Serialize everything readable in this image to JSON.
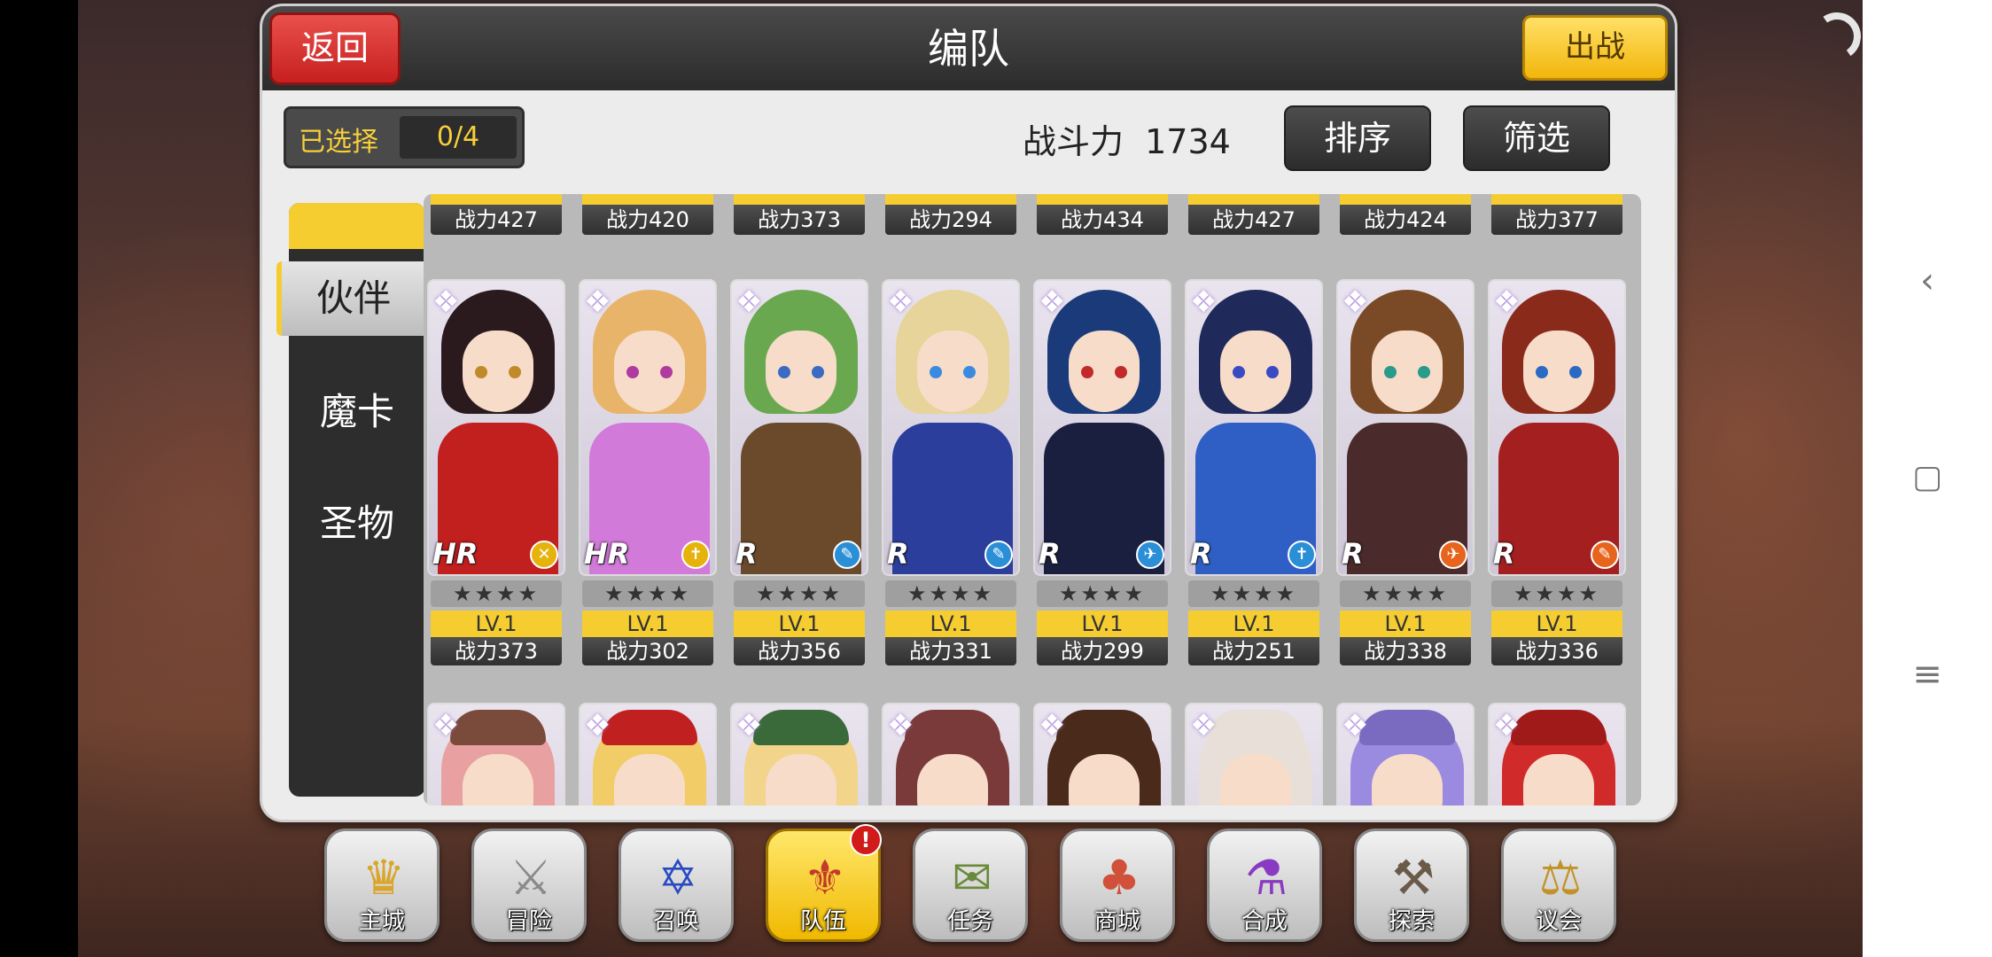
{
  "header": {
    "title": "编队",
    "back_label": "返回",
    "go_label": "出战"
  },
  "selection": {
    "label": "已选择",
    "value": "0/4"
  },
  "power": {
    "label": "战斗力",
    "value": "1734"
  },
  "toolbar": {
    "sort_label": "排序",
    "filter_label": "筛选"
  },
  "tabs": [
    {
      "label": "伙伴",
      "active": true
    },
    {
      "label": "魔卡",
      "active": false
    },
    {
      "label": "圣物",
      "active": false
    }
  ],
  "top_row_partial": [
    {
      "power": "战力427"
    },
    {
      "power": "战力420"
    },
    {
      "power": "战力373"
    },
    {
      "power": "战力294"
    },
    {
      "power": "战力434"
    },
    {
      "power": "战力427"
    },
    {
      "power": "战力424"
    },
    {
      "power": "战力377"
    }
  ],
  "cards": [
    {
      "rarity": "HR",
      "stars": "★★★★",
      "level": "LV.1",
      "power": "战力373",
      "element_color": "#e6b20c",
      "element_icon": "✕",
      "hair": "#2a1a1e",
      "outfit": "#c21f1f",
      "eye": "#c08a2a"
    },
    {
      "rarity": "HR",
      "stars": "★★★★",
      "level": "LV.1",
      "power": "战力302",
      "element_color": "#e6b20c",
      "element_icon": "✝",
      "hair": "#e8b46a",
      "outfit": "#d27ad9",
      "eye": "#b03aa0"
    },
    {
      "rarity": "R",
      "stars": "★★★★",
      "level": "LV.1",
      "power": "战力356",
      "element_color": "#2a8fd6",
      "element_icon": "✎",
      "hair": "#6aa84f",
      "outfit": "#6b4a2c",
      "eye": "#3a6ac2"
    },
    {
      "rarity": "R",
      "stars": "★★★★",
      "level": "LV.1",
      "power": "战力331",
      "element_color": "#2a8fd6",
      "element_icon": "✎",
      "hair": "#e7d49a",
      "outfit": "#2b3e9c",
      "eye": "#3a8ae0"
    },
    {
      "rarity": "R",
      "stars": "★★★★",
      "level": "LV.1",
      "power": "战力299",
      "element_color": "#2a8fd6",
      "element_icon": "✈",
      "hair": "#1b3a7a",
      "outfit": "#1a1f40",
      "eye": "#c22a2a"
    },
    {
      "rarity": "R",
      "stars": "★★★★",
      "level": "LV.1",
      "power": "战力251",
      "element_color": "#2a8fd6",
      "element_icon": "✝",
      "hair": "#1f2a5a",
      "outfit": "#2f5fc4",
      "eye": "#3a4ac2"
    },
    {
      "rarity": "R",
      "stars": "★★★★",
      "level": "LV.1",
      "power": "战力338",
      "element_color": "#e6641c",
      "element_icon": "✈",
      "hair": "#7a4a26",
      "outfit": "#4a2a2a",
      "eye": "#2a9a8a"
    },
    {
      "rarity": "R",
      "stars": "★★★★",
      "level": "LV.1",
      "power": "战力336",
      "element_color": "#e6641c",
      "element_icon": "✎",
      "hair": "#8a2a1a",
      "outfit": "#a42020",
      "eye": "#2a6ac2"
    }
  ],
  "bottom_row_partial": [
    {
      "hair": "#e8a0a0",
      "hat": "#7a4a3a"
    },
    {
      "hair": "#f2cc66",
      "hat": "#c02020"
    },
    {
      "hair": "#f2d48a",
      "hat": "#3a6a3a"
    },
    {
      "hair": "#7a3a3a",
      "hat": "#7a3a3a"
    },
    {
      "hair": "#4a2a1a",
      "hat": "#4a2a1a"
    },
    {
      "hair": "#e8e0d8",
      "hat": "#e8e0d8"
    },
    {
      "hair": "#9a8ae0",
      "hat": "#7a6ac0"
    },
    {
      "hair": "#d02a2a",
      "hat": "#a01a1a"
    }
  ],
  "bottom_menu": [
    {
      "label": "主城",
      "icon": "♛",
      "color": "#d9a52a",
      "active": false
    },
    {
      "label": "冒险",
      "icon": "⚔",
      "color": "#8a8a8a",
      "active": false
    },
    {
      "label": "召唤",
      "icon": "✡",
      "color": "#2a4ac2",
      "active": false
    },
    {
      "label": "队伍",
      "icon": "⚜",
      "color": "#c23a2a",
      "active": true,
      "badge": "!"
    },
    {
      "label": "任务",
      "icon": "✉",
      "color": "#6a8a3a",
      "active": false
    },
    {
      "label": "商城",
      "icon": "♣",
      "color": "#d0503a",
      "active": false
    },
    {
      "label": "合成",
      "icon": "⚗",
      "color": "#8a3ac2",
      "active": false
    },
    {
      "label": "探索",
      "icon": "⚒",
      "color": "#6a5a4a",
      "active": false
    },
    {
      "label": "议会",
      "icon": "⚖",
      "color": "#c2922a",
      "active": false
    }
  ],
  "navbar": {
    "back_icon": "‹",
    "home_icon": "▢",
    "menu_icon": "≡"
  }
}
